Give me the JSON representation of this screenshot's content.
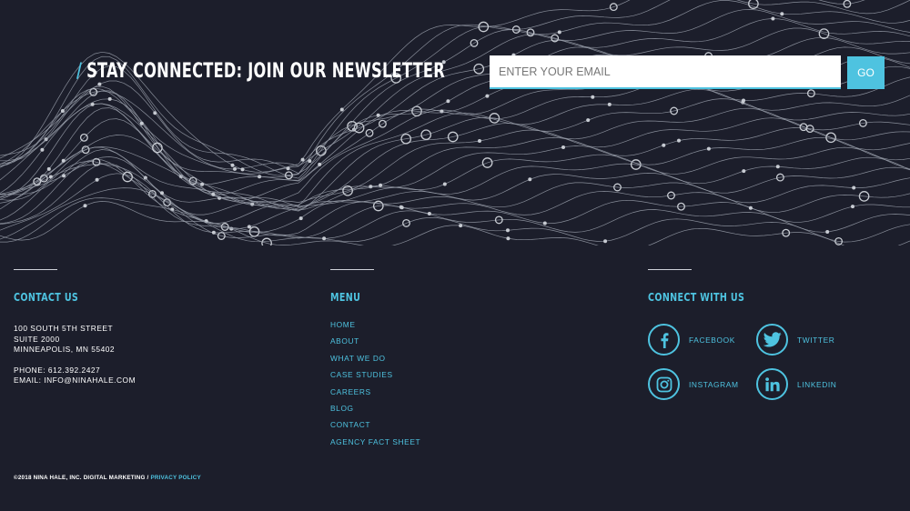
{
  "newsletter": {
    "slash": "/",
    "title": "STAY CONNECTED: JOIN OUR NEWSLETTER",
    "email_placeholder": "ENTER YOUR EMAIL",
    "go_label": "GO"
  },
  "contact": {
    "heading": "CONTACT US",
    "address": [
      "100 SOUTH 5TH STREET",
      "SUITE 2000",
      "MINNEAPOLIS, MN 55402"
    ],
    "phone": "PHONE: 612.392.2427",
    "email": "EMAIL: INFO@NINAHALE.COM"
  },
  "menu": {
    "heading": "MENU",
    "items": [
      "HOME",
      "ABOUT",
      "WHAT WE DO",
      "CASE STUDIES",
      "CAREERS",
      "BLOG",
      "CONTACT",
      "AGENCY FACT SHEET"
    ]
  },
  "connect": {
    "heading": "CONNECT WITH US",
    "items": [
      {
        "label": "FACEBOOK",
        "icon": "facebook-icon"
      },
      {
        "label": "TWITTER",
        "icon": "twitter-icon"
      },
      {
        "label": "INSTAGRAM",
        "icon": "instagram-icon"
      },
      {
        "label": "LINKEDIN",
        "icon": "linkedin-icon"
      }
    ]
  },
  "footer": {
    "copyright": "©2018 NINA HALE, INC. DIGITAL MARKETING",
    "separator": "/",
    "privacy_label": "PRIVACY POLICY"
  },
  "colors": {
    "background": "#1c1e2b",
    "accent": "#4ec3e0",
    "text": "#ffffff",
    "wave": "#9aa0ab"
  }
}
